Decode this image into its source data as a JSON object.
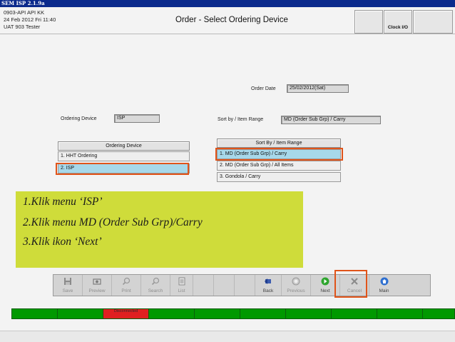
{
  "window": {
    "title": "SEM ISP 2.1.9a"
  },
  "header": {
    "store": "0903-API API KK",
    "datetime": "24 Feb 2012 Fri 11:40",
    "user": "UAT 903 Tester",
    "title": "Order - Select Ordering Device",
    "clock_button": "Clock I/O"
  },
  "form": {
    "order_date_label": "Order Date",
    "order_date_value": "25/02/2012(Sat)",
    "ordering_device_label": "Ordering Device",
    "ordering_device_value": "ISP",
    "sort_label": "Sort by / Item Range",
    "sort_value": "MD (Order Sub Grp) / Carry"
  },
  "ordering_device_panel": {
    "header": "Ordering Device",
    "items": [
      {
        "label": "1. HHT Ordering"
      },
      {
        "label": "2. ISP"
      }
    ]
  },
  "sort_panel": {
    "header": "Sort By / Item Range",
    "items": [
      {
        "label": "1. MD (Order Sub Grp) / Carry"
      },
      {
        "label": "2. MD (Order Sub Grp) / All Items"
      },
      {
        "label": "3. Gondola / Carry"
      }
    ]
  },
  "instructions": {
    "line1": "1.Klik menu ‘ISP’",
    "line2": "2.Klik menu MD (Order Sub Grp)/Carry",
    "line3": "3.Klik ikon ‘Next’"
  },
  "toolbar": {
    "save": "Save",
    "preview": "Preview",
    "print": "Print",
    "search": "Search",
    "list": "List",
    "back": "Back",
    "previous": "Previous",
    "next": "Next",
    "cancel": "Cancel",
    "main": "Main"
  },
  "status": {
    "connection": "Disconnected"
  },
  "colors": {
    "selection": "#a7d8ea",
    "highlight": "#e0541a",
    "note_bg": "#cfdc3a",
    "status_ok": "#009900",
    "status_error": "#e02020"
  }
}
